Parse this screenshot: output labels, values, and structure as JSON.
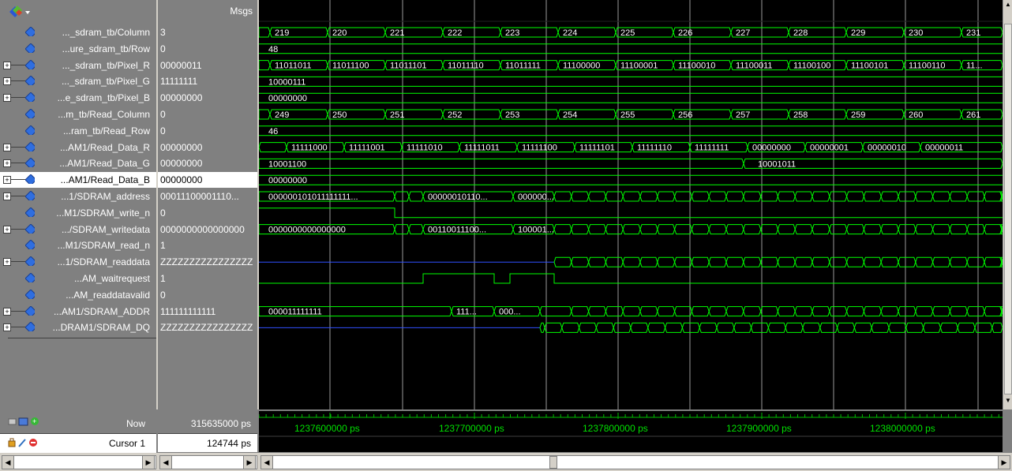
{
  "header": {
    "msgs_label": "Msgs"
  },
  "signals": [
    {
      "name": "..._sdram_tb/Column",
      "value": "3",
      "expandable": false
    },
    {
      "name": "...ure_sdram_tb/Row",
      "value": "0",
      "expandable": false
    },
    {
      "name": "..._sdram_tb/Pixel_R",
      "value": "00000011",
      "expandable": true
    },
    {
      "name": "..._sdram_tb/Pixel_G",
      "value": "11111111",
      "expandable": true
    },
    {
      "name": "...e_sdram_tb/Pixel_B",
      "value": "00000000",
      "expandable": true
    },
    {
      "name": "...m_tb/Read_Column",
      "value": "0",
      "expandable": false
    },
    {
      "name": "...ram_tb/Read_Row",
      "value": "0",
      "expandable": false
    },
    {
      "name": "...AM1/Read_Data_R",
      "value": "00000000",
      "expandable": true
    },
    {
      "name": "...AM1/Read_Data_G",
      "value": "00000000",
      "expandable": true
    },
    {
      "name": "...AM1/Read_Data_B",
      "value": "00000000",
      "expandable": true,
      "selected": true
    },
    {
      "name": "...1/SDRAM_address",
      "value": "00011100001110...",
      "expandable": true
    },
    {
      "name": "...M1/SDRAM_write_n",
      "value": "0",
      "expandable": false
    },
    {
      "name": ".../SDRAM_writedata",
      "value": "0000000000000000",
      "expandable": true
    },
    {
      "name": "...M1/SDRAM_read_n",
      "value": "1",
      "expandable": false
    },
    {
      "name": "...1/SDRAM_readdata",
      "value": "ZZZZZZZZZZZZZZZZ",
      "expandable": true
    },
    {
      "name": "...AM_waitrequest",
      "value": "1",
      "expandable": false
    },
    {
      "name": "...AM_readdatavalid",
      "value": "0",
      "expandable": false
    },
    {
      "name": "...AM1/SDRAM_ADDR",
      "value": "111111111111",
      "expandable": true
    },
    {
      "name": "...DRAM1/SDRAM_DQ",
      "value": "ZZZZZZZZZZZZZZZZ",
      "expandable": true
    }
  ],
  "waves": {
    "column_labels": [
      "219",
      "220",
      "221",
      "222",
      "223",
      "224",
      "225",
      "226",
      "227",
      "228",
      "229",
      "230",
      "231"
    ],
    "row_label": "48",
    "pixel_r_labels": [
      "11011011",
      "11011100",
      "11011101",
      "11011110",
      "11011111",
      "11100000",
      "11100001",
      "11100010",
      "11100011",
      "11100100",
      "11100101",
      "11100110",
      "11..."
    ],
    "pixel_g_label": "10000111",
    "pixel_b_label": "00000000",
    "read_column_labels": [
      "249",
      "250",
      "251",
      "252",
      "253",
      "254",
      "255",
      "256",
      "257",
      "258",
      "259",
      "260",
      "261"
    ],
    "read_row_label": "46",
    "read_data_r_labels": [
      "11111000",
      "11111001",
      "11111010",
      "11111011",
      "11111100",
      "11111101",
      "11111110",
      "11111111",
      "00000000",
      "00000001",
      "00000010",
      "00000011"
    ],
    "read_data_g_labels": [
      "10001100",
      "10001011"
    ],
    "read_data_b_label": "00000000",
    "address_labels": [
      "000000101011111111...",
      "00000010110...",
      "000000..."
    ],
    "writedata_labels": [
      "0000000000000000",
      "00110011100...",
      "100001..."
    ],
    "addr_labels": [
      "000011111111",
      "111...",
      "000..."
    ]
  },
  "footer": {
    "now_label": "Now",
    "now_value": "315635000 ps",
    "cursor_label": "Cursor 1",
    "cursor_value": "124744 ps",
    "time_labels": [
      "1237600000 ps",
      "1237700000 ps",
      "1237800000 ps",
      "1237900000 ps",
      "1238000000 ps"
    ]
  },
  "colors": {
    "wave": "#00ff00",
    "hiz": "#3050ff",
    "grid": "#9a9a9a",
    "selected_row": "#ffffff"
  },
  "icons": [
    "waveform-menu-icon",
    "signal-diamond-icon",
    "expand-plus-icon",
    "now-icons",
    "cursor-icons"
  ]
}
